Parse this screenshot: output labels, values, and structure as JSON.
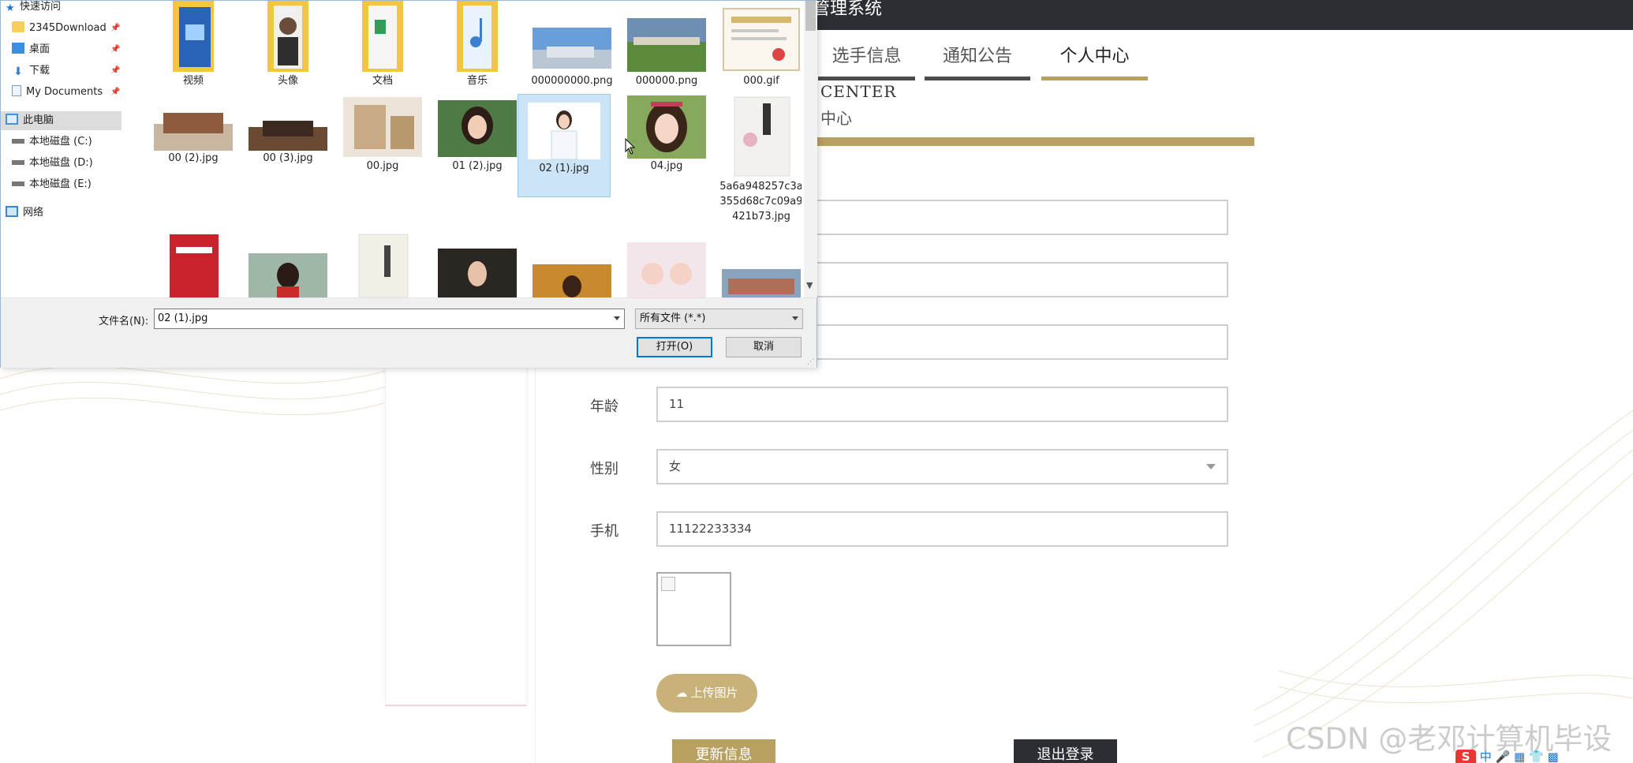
{
  "web": {
    "system_title": "管理系统",
    "nav_tabs": [
      {
        "label": "选手信息"
      },
      {
        "label": "通知公告"
      },
      {
        "label": "个人中心"
      }
    ],
    "section_en": "CENTER",
    "section_cn": "中心",
    "form": {
      "age_label": "年龄",
      "age_value": "11",
      "gender_label": "性别",
      "gender_value": "女",
      "phone_label": "手机",
      "phone_value": "11122233334"
    },
    "upload_label": "上传图片",
    "update_label": "更新信息",
    "logout_label": "退出登录",
    "colors": {
      "accent_gold": "#b8a160",
      "dark": "#2b2e33"
    }
  },
  "dialog": {
    "tree": [
      {
        "label": "快速访问",
        "icon": "star-icon"
      },
      {
        "label": "2345Download",
        "icon": "folder-icon"
      },
      {
        "label": "桌面",
        "icon": "desktop-icon"
      },
      {
        "label": "下载",
        "icon": "download-icon"
      },
      {
        "label": "My Documents",
        "icon": "document-icon"
      },
      {
        "label": "此电脑",
        "icon": "computer-icon"
      },
      {
        "label": "本地磁盘 (C:)",
        "icon": "drive-icon"
      },
      {
        "label": "本地磁盘 (D:)",
        "icon": "drive-icon"
      },
      {
        "label": "本地磁盘 (E:)",
        "icon": "drive-icon"
      },
      {
        "label": "网络",
        "icon": "network-icon"
      }
    ],
    "files": [
      {
        "name": "视频"
      },
      {
        "name": "头像"
      },
      {
        "name": "文档"
      },
      {
        "name": "音乐"
      },
      {
        "name": "000000000.png"
      },
      {
        "name": "000000.png"
      },
      {
        "name": "000.gif"
      },
      {
        "name": "00 (2).jpg"
      },
      {
        "name": "00 (3).jpg"
      },
      {
        "name": "00.jpg"
      },
      {
        "name": "01 (2).jpg"
      },
      {
        "name": "02 (1).jpg"
      },
      {
        "name": "04.jpg"
      },
      {
        "name": "5a6a948257c3a355d68c7c09a9421b73.jpg"
      }
    ],
    "filename_label": "文件名(N):",
    "filename_value": "02 (1).jpg",
    "filetype_value": "所有文件 (*.*)",
    "open_label": "打开(O)",
    "cancel_label": "取消"
  },
  "watermark": "CSDN @老邓计算机毕设",
  "ime": {
    "logo": "S",
    "mode": "中"
  }
}
